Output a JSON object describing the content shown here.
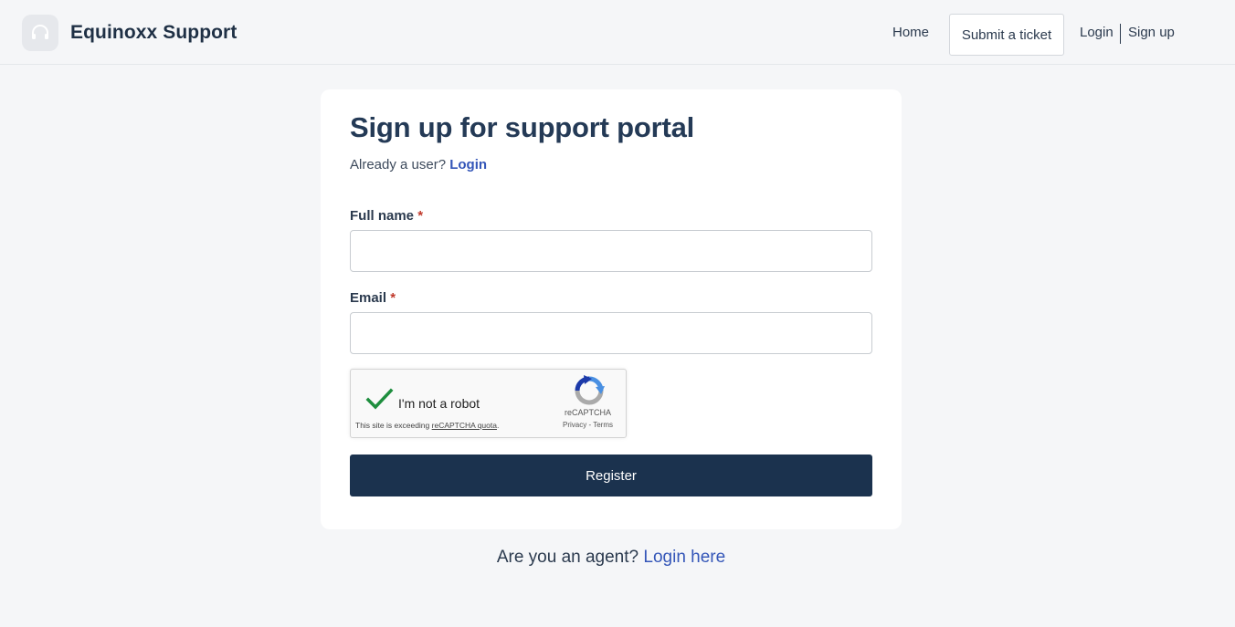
{
  "header": {
    "brand": "Equinoxx Support",
    "logo_icon": "headset-icon",
    "nav": {
      "home": "Home",
      "submit_ticket": "Submit a ticket",
      "login": "Login",
      "signup": "Sign up"
    }
  },
  "form": {
    "title": "Sign up for support portal",
    "already_text": "Already a user?",
    "login_link": "Login",
    "full_name_label": "Full name",
    "email_label": "Email",
    "required_mark": "*",
    "full_name_value": "",
    "email_value": "",
    "register_label": "Register"
  },
  "captcha": {
    "label": "I'm not a robot",
    "checked": true,
    "warning_prefix": "This site is exceeding",
    "warning_link": "reCAPTCHA quota",
    "warning_suffix": ".",
    "brand": "reCAPTCHA",
    "privacy": "Privacy",
    "separator": "-",
    "terms": "Terms"
  },
  "footer": {
    "agent_text": "Are you an agent?",
    "agent_link": "Login here"
  },
  "colors": {
    "primary": "#1b324e",
    "link": "#3456b8",
    "required": "#c0392b",
    "check": "#1e8e3e"
  }
}
